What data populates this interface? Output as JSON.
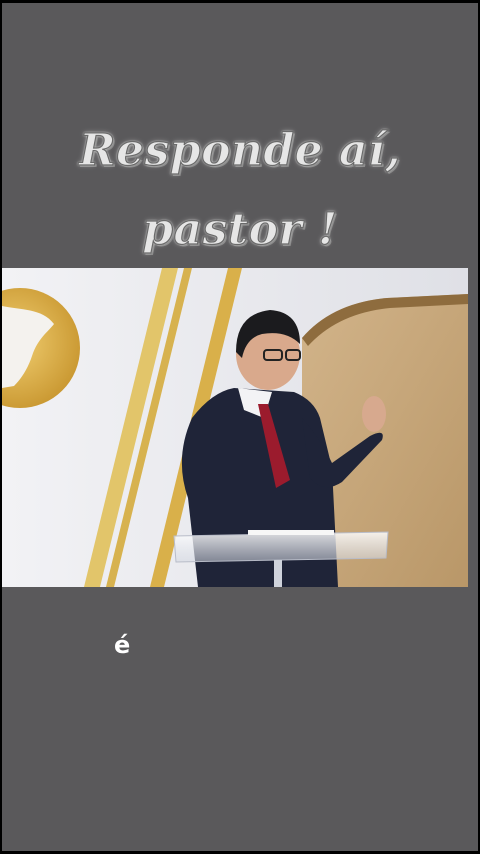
{
  "title": {
    "line1": "Responde aí,",
    "line2": "pastor !"
  },
  "video": {
    "description_icon": "video-frame"
  },
  "caption": {
    "text": "é"
  },
  "colors": {
    "background": "#5a595b",
    "gold": "#d9b04a",
    "suit": "#1f2438",
    "tie": "#9b1b2d",
    "wood": "#c8a878"
  }
}
